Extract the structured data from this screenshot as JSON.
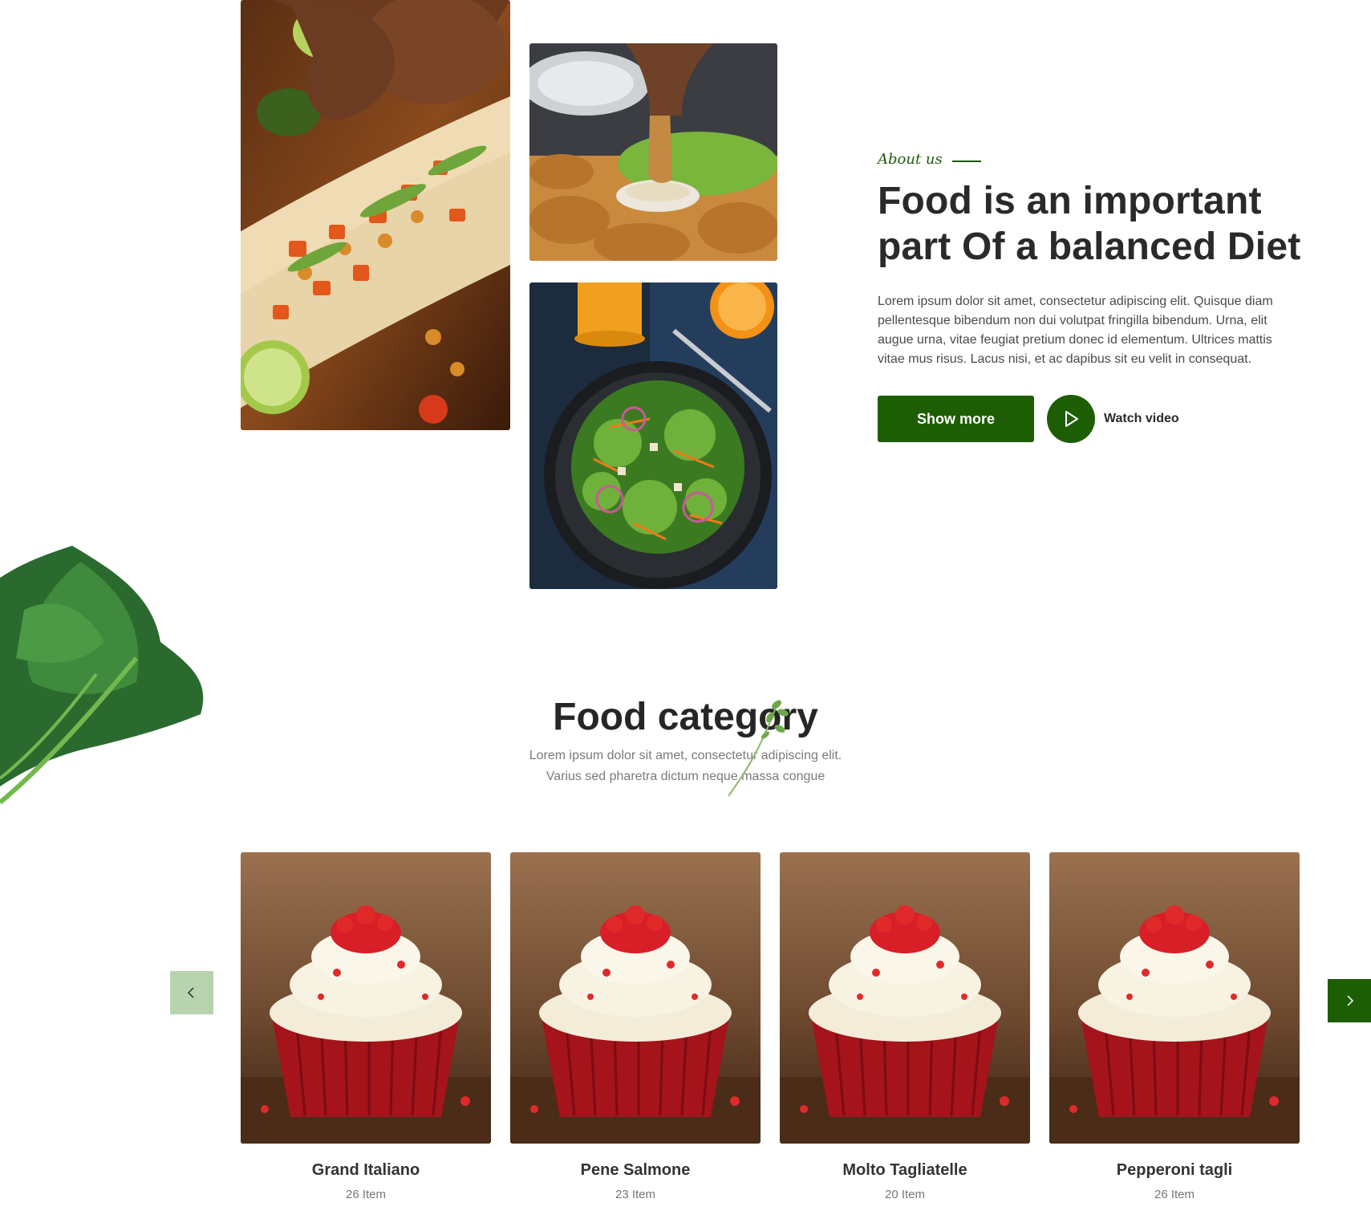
{
  "about": {
    "eyebrow": "About us",
    "title": "Food is an important part Of a balanced Diet",
    "body": "Lorem ipsum dolor sit amet, consectetur adipiscing elit. Quisque diam pellentesque bibendum non dui volutpat fringilla bibendum. Urna, elit augue urna, vitae feugiat pretium donec id elementum. Ultrices mattis vitae mus risus. Lacus nisi, et ac dapibus sit eu velit in consequat.",
    "show_more_label": "Show more",
    "watch_video_label": "Watch video"
  },
  "category": {
    "title": "Food category",
    "subtitle_line1": "Lorem ipsum dolor sit amet, consectetur adipiscing elit.",
    "subtitle_line2": "Varius sed pharetra dictum neque massa congue",
    "items": [
      {
        "name": "Grand Italiano",
        "count": "26 Item"
      },
      {
        "name": "Pene Salmone",
        "count": "23 Item"
      },
      {
        "name": "Molto Tagliatelle",
        "count": "20 Item"
      },
      {
        "name": "Pepperoni tagli",
        "count": "26 Item"
      }
    ]
  },
  "icons": {
    "play": "play-icon",
    "prev": "chevron-left-icon",
    "next": "chevron-right-icon"
  },
  "colors": {
    "brand_green": "#1d5e04",
    "prev_button_bg": "#b7d3b0",
    "heading": "#2a2a2a",
    "body_text": "#4a4a4a"
  }
}
